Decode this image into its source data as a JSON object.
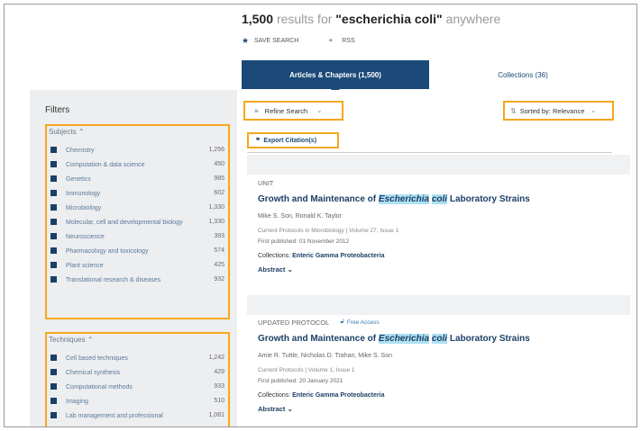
{
  "header": {
    "result_count": "1,500",
    "results_for": "results for",
    "query": "\"escherichia coli\"",
    "scope": "anywhere",
    "save_search": "SAVE SEARCH",
    "rss": "RSS"
  },
  "tabs": [
    {
      "label": "Articles & Chapters (1,500)",
      "active": true
    },
    {
      "label": "Collections (36)",
      "active": false
    }
  ],
  "filters": {
    "title": "Filters",
    "subjects": {
      "label": "Subjects",
      "items": [
        {
          "label": "Chemistry",
          "count": "1,256"
        },
        {
          "label": "Computation & data science",
          "count": "450"
        },
        {
          "label": "Genetics",
          "count": "985"
        },
        {
          "label": "Immunology",
          "count": "602"
        },
        {
          "label": "Microbiology",
          "count": "1,330"
        },
        {
          "label": "Molecular, cell and developmental biology",
          "count": "1,330"
        },
        {
          "label": "Neuroscience",
          "count": "393"
        },
        {
          "label": "Pharmacology and toxicology",
          "count": "574"
        },
        {
          "label": "Plant science",
          "count": "425"
        },
        {
          "label": "Translational research & diseases",
          "count": "932"
        }
      ]
    },
    "techniques": {
      "label": "Techniques",
      "items": [
        {
          "label": "Cell based techniques",
          "count": "1,242"
        },
        {
          "label": "Chemical synthesis",
          "count": "429"
        },
        {
          "label": "Computational methods",
          "count": "933"
        },
        {
          "label": "Imaging",
          "count": "510"
        },
        {
          "label": "Lab management and professional",
          "count": "1,081"
        }
      ]
    }
  },
  "toolbar": {
    "refine": "Refine Search",
    "sort": "Sorted by: Relevance",
    "export": "Export Citation(s)"
  },
  "results": [
    {
      "type": "UNIT",
      "title_pre": "Growth and Maintenance of ",
      "title_hl1": "Escherichia",
      "title_mid": " ",
      "title_hl2": "coli",
      "title_post": " Laboratory Strains",
      "authors": "Mike S. Son, Ronald K. Taylor",
      "meta": "Current Protocols in Microbiology | Volume 27, Issue 1",
      "published": "First published: 01 November 2012",
      "collections_label": "Collections:",
      "collections_value": "Enteric Gamma Proteobacteria",
      "abstract": "Abstract"
    },
    {
      "type": "UPDATED PROTOCOL",
      "free_access": "Free Access",
      "title_pre": "Growth and Maintenance of ",
      "title_hl1": "Escherichia",
      "title_mid": " ",
      "title_hl2": "coli",
      "title_post": " Laboratory Strains",
      "authors": "Amie R. Tuttle, Nicholas D. Trahan, Mike S. Son",
      "meta": "Current Protocols | Volume 1, Issue 1",
      "published": "First published: 20 January 2021",
      "collections_label": "Collections:",
      "collections_value": "Enteric Gamma Proteobacteria",
      "abstract": "Abstract"
    }
  ],
  "colors": {
    "accent": "#1c4a78",
    "highlight_box": "#f4a81d",
    "term_highlight": "#aee0f3"
  }
}
